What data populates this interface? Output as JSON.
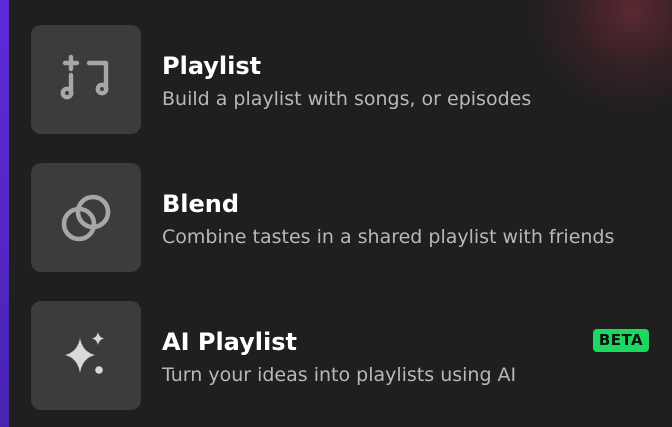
{
  "colors": {
    "background": "#1f1f1f",
    "tile": "#3d3b3c",
    "title": "#ffffff",
    "subtitle": "#b8b8b8",
    "accent": "#1ed760",
    "edge": "#5b2bd9"
  },
  "menu": {
    "items": [
      {
        "title": "Playlist",
        "subtitle": "Build a playlist with songs, or episodes",
        "icon": "music-plus-icon"
      },
      {
        "title": "Blend",
        "subtitle": "Combine tastes in a shared playlist with friends",
        "icon": "blend-icon"
      },
      {
        "title": "AI Playlist",
        "subtitle": "Turn your ideas into playlists using AI",
        "icon": "sparkle-icon",
        "badge": "BETA"
      }
    ]
  }
}
